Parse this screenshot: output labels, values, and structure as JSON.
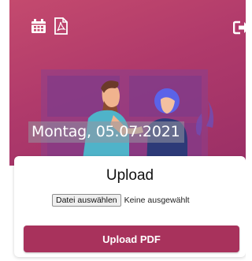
{
  "header": {
    "date_text": "Montag, 05.07.2021",
    "icons": {
      "calendar": "calendar-icon",
      "pdf": "file-pdf-icon",
      "logout": "sign-out-icon"
    },
    "gradient_colors": [
      "#c44a6e",
      "#9a2f66"
    ]
  },
  "upload": {
    "title": "Upload",
    "file_button_label": "Datei auswählen",
    "file_status": "Keine ausgewählt",
    "submit_label": "Upload PDF",
    "accent_color": "#a8325c"
  }
}
